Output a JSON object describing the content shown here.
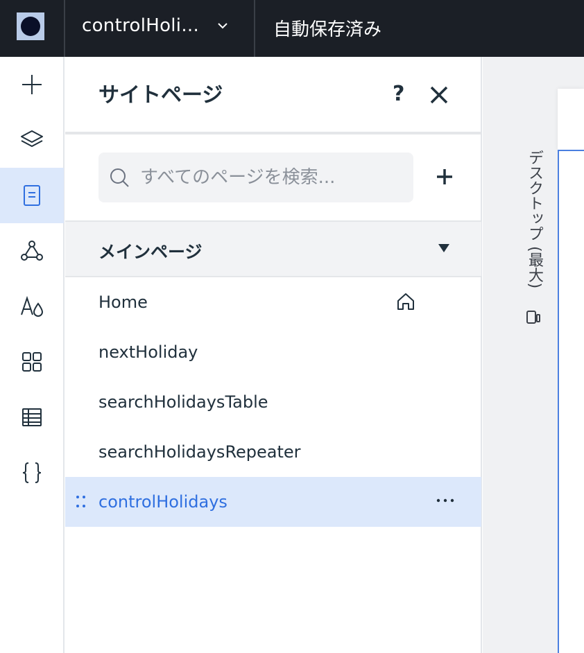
{
  "topbar": {
    "site_name": "controlHoli...",
    "autosave_status": "自動保存済み"
  },
  "rail": {
    "items": [
      {
        "icon": "plus-icon",
        "active": false
      },
      {
        "icon": "layers-icon",
        "active": false
      },
      {
        "icon": "pages-icon",
        "active": true
      },
      {
        "icon": "connections-icon",
        "active": false
      },
      {
        "icon": "theme-icon",
        "active": false
      },
      {
        "icon": "apps-grid-icon",
        "active": false
      },
      {
        "icon": "table-icon",
        "active": false
      },
      {
        "icon": "code-braces-icon",
        "active": false
      }
    ]
  },
  "panel": {
    "title": "サイトページ",
    "help_label": "?",
    "search": {
      "value": "",
      "placeholder": "すべてのページを検索..."
    },
    "section": {
      "title": "メインページ",
      "expanded": true
    },
    "pages": [
      {
        "label": "Home",
        "is_home": true,
        "selected": false
      },
      {
        "label": "nextHoliday",
        "is_home": false,
        "selected": false
      },
      {
        "label": "searchHolidaysTable",
        "is_home": false,
        "selected": false
      },
      {
        "label": "searchHolidaysRepeater",
        "is_home": false,
        "selected": false
      },
      {
        "label": "controlHolidays",
        "is_home": false,
        "selected": true
      }
    ]
  },
  "canvas": {
    "breakpoint_label": "デスクトップ (最大)"
  },
  "colors": {
    "topbar_bg": "#1b1f26",
    "accent": "#2f6fe0",
    "selected_bg": "#dce8fb"
  }
}
